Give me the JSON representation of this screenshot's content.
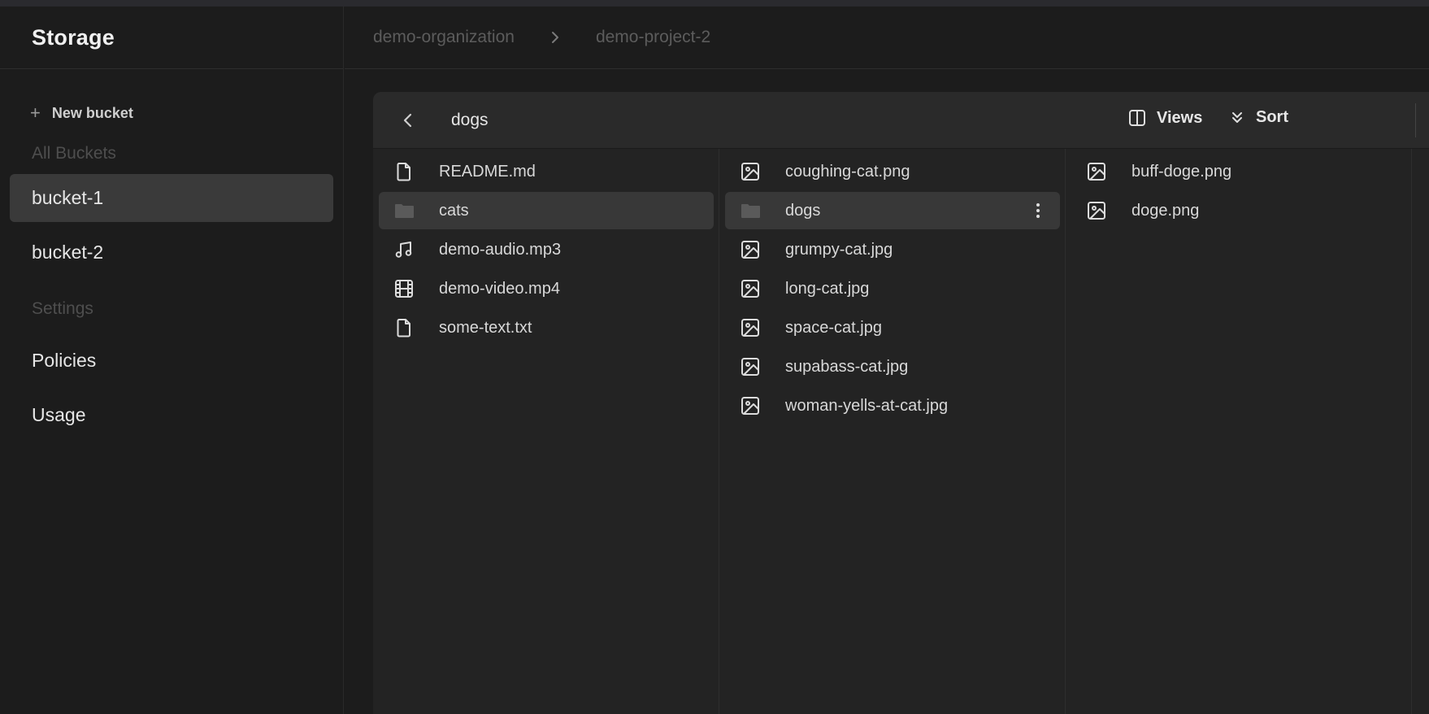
{
  "sidebar": {
    "title": "Storage",
    "new_bucket": "New bucket",
    "buckets_label": "All Buckets",
    "buckets": [
      {
        "label": "bucket-1",
        "active": true
      },
      {
        "label": "bucket-2",
        "active": false
      }
    ],
    "settings_label": "Settings",
    "settings": [
      {
        "label": "Policies"
      },
      {
        "label": "Usage"
      }
    ]
  },
  "breadcrumb": {
    "organization": "demo-organization",
    "project": "demo-project-2"
  },
  "explorer": {
    "current_folder": "dogs",
    "views_label": "Views",
    "sort_label": "Sort",
    "columns": [
      {
        "items": [
          {
            "name": "README.md",
            "icon": "file-icon"
          },
          {
            "name": "cats",
            "icon": "folder-icon",
            "selected": true
          },
          {
            "name": "demo-audio.mp3",
            "icon": "music-icon"
          },
          {
            "name": "demo-video.mp4",
            "icon": "film-icon"
          },
          {
            "name": "some-text.txt",
            "icon": "file-icon"
          }
        ]
      },
      {
        "items": [
          {
            "name": "coughing-cat.png",
            "icon": "image-icon"
          },
          {
            "name": "dogs",
            "icon": "folder-icon",
            "selected": true
          },
          {
            "name": "grumpy-cat.jpg",
            "icon": "image-icon"
          },
          {
            "name": "long-cat.jpg",
            "icon": "image-icon"
          },
          {
            "name": "space-cat.jpg",
            "icon": "image-icon"
          },
          {
            "name": "supabass-cat.jpg",
            "icon": "image-icon"
          },
          {
            "name": "woman-yells-at-cat.jpg",
            "icon": "image-icon"
          }
        ]
      },
      {
        "items": [
          {
            "name": "buff-doge.png",
            "icon": "image-icon"
          },
          {
            "name": "doge.png",
            "icon": "image-icon"
          }
        ]
      }
    ]
  },
  "colors": {
    "background": "#1c1c1c",
    "panel": "#232323",
    "selected_row": "#383838",
    "active_nav": "#3a3a3a"
  }
}
